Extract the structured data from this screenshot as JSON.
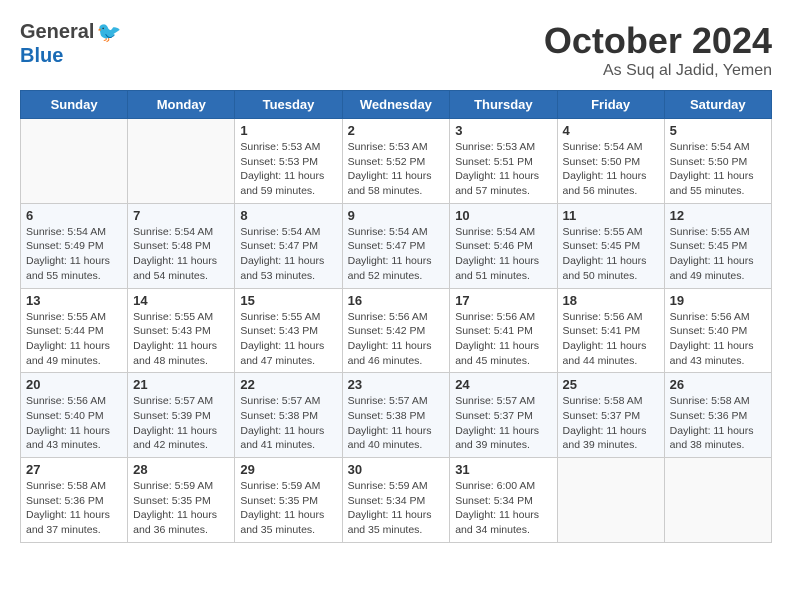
{
  "header": {
    "logo_general": "General",
    "logo_blue": "Blue",
    "month": "October 2024",
    "location": "As Suq al Jadid, Yemen"
  },
  "weekdays": [
    "Sunday",
    "Monday",
    "Tuesday",
    "Wednesday",
    "Thursday",
    "Friday",
    "Saturday"
  ],
  "weeks": [
    [
      {
        "day": "",
        "info": ""
      },
      {
        "day": "",
        "info": ""
      },
      {
        "day": "1",
        "info": "Sunrise: 5:53 AM\nSunset: 5:53 PM\nDaylight: 11 hours and 59 minutes."
      },
      {
        "day": "2",
        "info": "Sunrise: 5:53 AM\nSunset: 5:52 PM\nDaylight: 11 hours and 58 minutes."
      },
      {
        "day": "3",
        "info": "Sunrise: 5:53 AM\nSunset: 5:51 PM\nDaylight: 11 hours and 57 minutes."
      },
      {
        "day": "4",
        "info": "Sunrise: 5:54 AM\nSunset: 5:50 PM\nDaylight: 11 hours and 56 minutes."
      },
      {
        "day": "5",
        "info": "Sunrise: 5:54 AM\nSunset: 5:50 PM\nDaylight: 11 hours and 55 minutes."
      }
    ],
    [
      {
        "day": "6",
        "info": "Sunrise: 5:54 AM\nSunset: 5:49 PM\nDaylight: 11 hours and 55 minutes."
      },
      {
        "day": "7",
        "info": "Sunrise: 5:54 AM\nSunset: 5:48 PM\nDaylight: 11 hours and 54 minutes."
      },
      {
        "day": "8",
        "info": "Sunrise: 5:54 AM\nSunset: 5:47 PM\nDaylight: 11 hours and 53 minutes."
      },
      {
        "day": "9",
        "info": "Sunrise: 5:54 AM\nSunset: 5:47 PM\nDaylight: 11 hours and 52 minutes."
      },
      {
        "day": "10",
        "info": "Sunrise: 5:54 AM\nSunset: 5:46 PM\nDaylight: 11 hours and 51 minutes."
      },
      {
        "day": "11",
        "info": "Sunrise: 5:55 AM\nSunset: 5:45 PM\nDaylight: 11 hours and 50 minutes."
      },
      {
        "day": "12",
        "info": "Sunrise: 5:55 AM\nSunset: 5:45 PM\nDaylight: 11 hours and 49 minutes."
      }
    ],
    [
      {
        "day": "13",
        "info": "Sunrise: 5:55 AM\nSunset: 5:44 PM\nDaylight: 11 hours and 49 minutes."
      },
      {
        "day": "14",
        "info": "Sunrise: 5:55 AM\nSunset: 5:43 PM\nDaylight: 11 hours and 48 minutes."
      },
      {
        "day": "15",
        "info": "Sunrise: 5:55 AM\nSunset: 5:43 PM\nDaylight: 11 hours and 47 minutes."
      },
      {
        "day": "16",
        "info": "Sunrise: 5:56 AM\nSunset: 5:42 PM\nDaylight: 11 hours and 46 minutes."
      },
      {
        "day": "17",
        "info": "Sunrise: 5:56 AM\nSunset: 5:41 PM\nDaylight: 11 hours and 45 minutes."
      },
      {
        "day": "18",
        "info": "Sunrise: 5:56 AM\nSunset: 5:41 PM\nDaylight: 11 hours and 44 minutes."
      },
      {
        "day": "19",
        "info": "Sunrise: 5:56 AM\nSunset: 5:40 PM\nDaylight: 11 hours and 43 minutes."
      }
    ],
    [
      {
        "day": "20",
        "info": "Sunrise: 5:56 AM\nSunset: 5:40 PM\nDaylight: 11 hours and 43 minutes."
      },
      {
        "day": "21",
        "info": "Sunrise: 5:57 AM\nSunset: 5:39 PM\nDaylight: 11 hours and 42 minutes."
      },
      {
        "day": "22",
        "info": "Sunrise: 5:57 AM\nSunset: 5:38 PM\nDaylight: 11 hours and 41 minutes."
      },
      {
        "day": "23",
        "info": "Sunrise: 5:57 AM\nSunset: 5:38 PM\nDaylight: 11 hours and 40 minutes."
      },
      {
        "day": "24",
        "info": "Sunrise: 5:57 AM\nSunset: 5:37 PM\nDaylight: 11 hours and 39 minutes."
      },
      {
        "day": "25",
        "info": "Sunrise: 5:58 AM\nSunset: 5:37 PM\nDaylight: 11 hours and 39 minutes."
      },
      {
        "day": "26",
        "info": "Sunrise: 5:58 AM\nSunset: 5:36 PM\nDaylight: 11 hours and 38 minutes."
      }
    ],
    [
      {
        "day": "27",
        "info": "Sunrise: 5:58 AM\nSunset: 5:36 PM\nDaylight: 11 hours and 37 minutes."
      },
      {
        "day": "28",
        "info": "Sunrise: 5:59 AM\nSunset: 5:35 PM\nDaylight: 11 hours and 36 minutes."
      },
      {
        "day": "29",
        "info": "Sunrise: 5:59 AM\nSunset: 5:35 PM\nDaylight: 11 hours and 35 minutes."
      },
      {
        "day": "30",
        "info": "Sunrise: 5:59 AM\nSunset: 5:34 PM\nDaylight: 11 hours and 35 minutes."
      },
      {
        "day": "31",
        "info": "Sunrise: 6:00 AM\nSunset: 5:34 PM\nDaylight: 11 hours and 34 minutes."
      },
      {
        "day": "",
        "info": ""
      },
      {
        "day": "",
        "info": ""
      }
    ]
  ]
}
